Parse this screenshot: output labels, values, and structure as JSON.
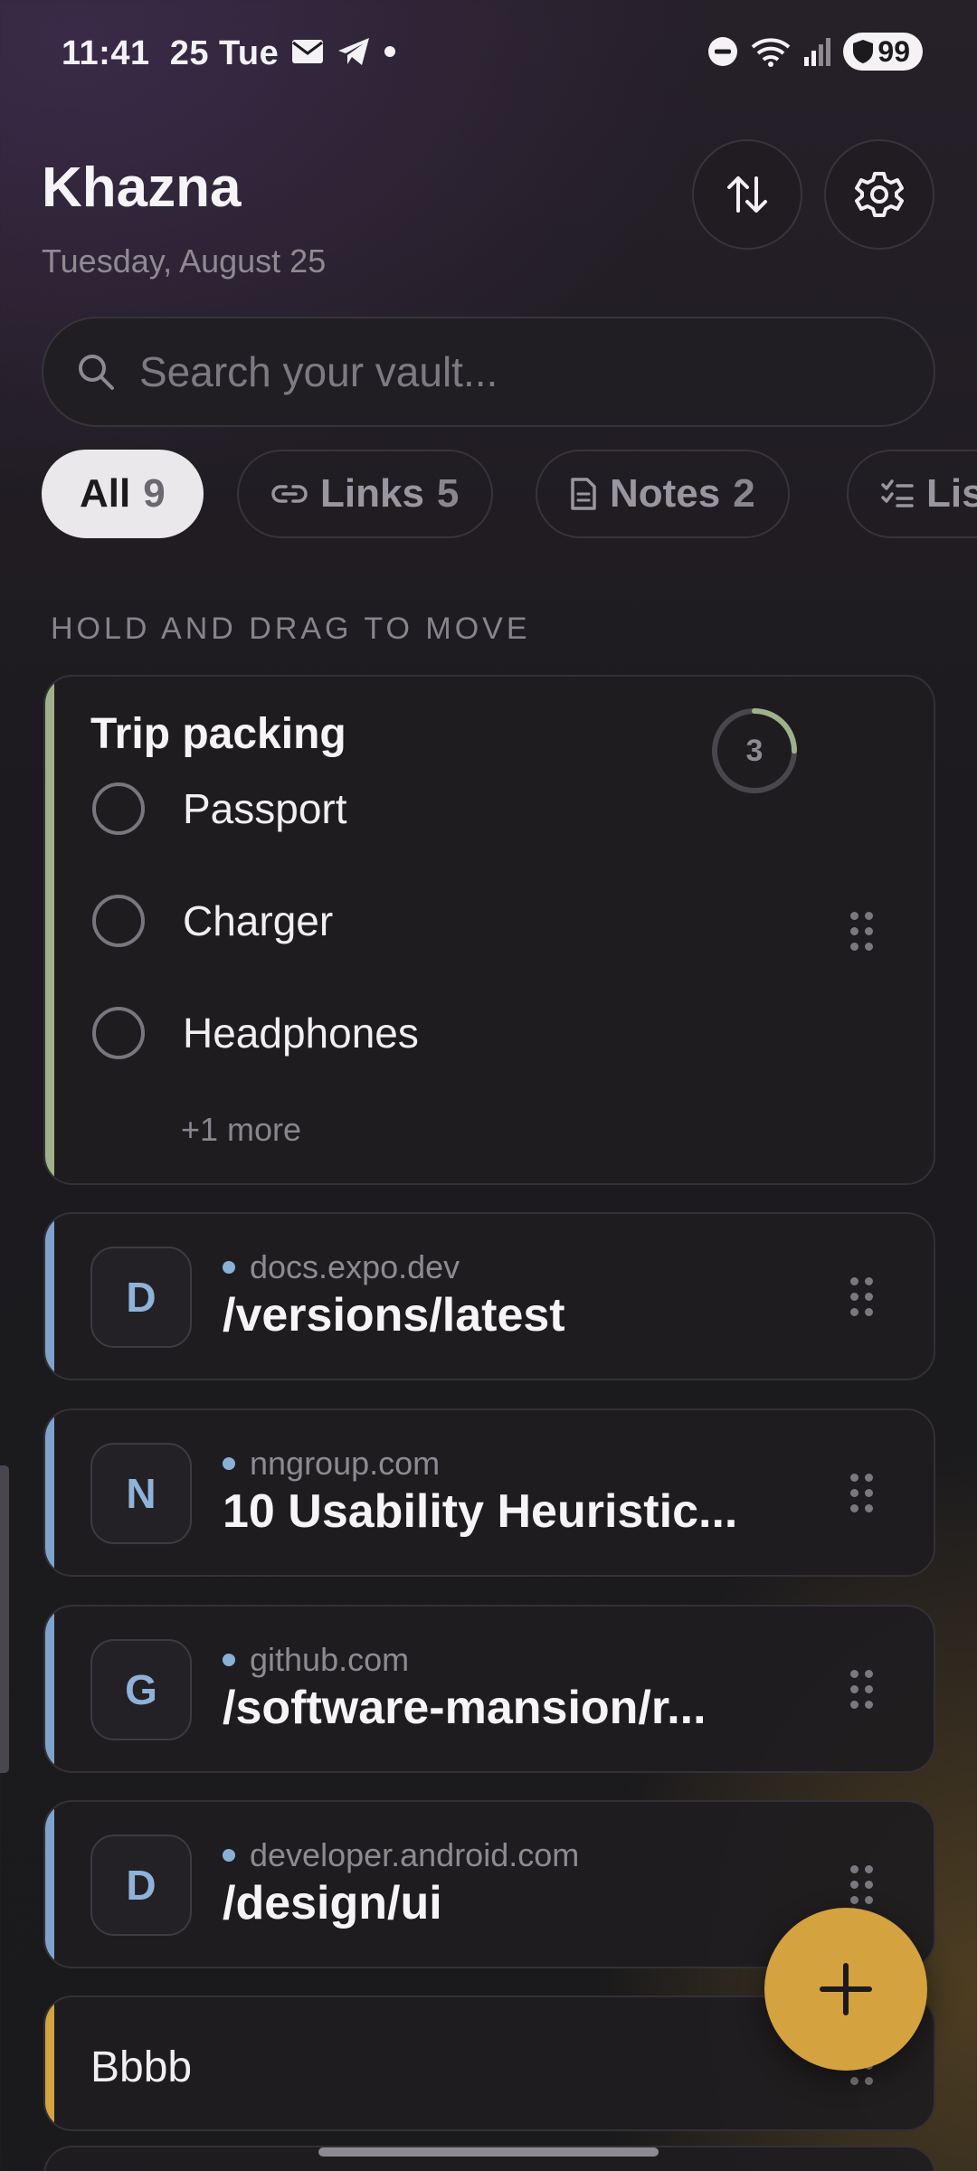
{
  "status_bar": {
    "time": "11:41",
    "date": "25 Tue",
    "battery": "99",
    "icons_left": [
      "mail-icon",
      "telegram-icon",
      "dot-icon"
    ],
    "icons_right": [
      "dnd-icon",
      "wifi-icon",
      "signal-icon",
      "battery-icon"
    ]
  },
  "header": {
    "title": "Khazna",
    "date": "Tuesday, August 25",
    "sort_icon": "sort-arrows-icon",
    "settings_icon": "gear-icon"
  },
  "search": {
    "placeholder": "Search your vault..."
  },
  "filters": [
    {
      "label": "All",
      "count": "9",
      "selected": true
    },
    {
      "label": "Links",
      "count": "5",
      "icon": "link-icon"
    },
    {
      "label": "Notes",
      "count": "2",
      "icon": "document-icon"
    },
    {
      "label": "Lis",
      "count": "",
      "icon": "checklist-icon"
    }
  ],
  "section_label": "HOLD AND DRAG TO MOVE",
  "list_card": {
    "title": "Trip packing",
    "progress_count": "3",
    "progress_fraction": 0.25,
    "items": [
      "Passport",
      "Charger",
      "Headphones"
    ],
    "more": "+1 more",
    "accent": "#9fb18a"
  },
  "links": [
    {
      "initial": "D",
      "domain": "docs.expo.dev",
      "title": "/versions/latest"
    },
    {
      "initial": "N",
      "domain": "nngroup.com",
      "title": "10 Usability Heuristic..."
    },
    {
      "initial": "G",
      "domain": "github.com",
      "title": "/software-mansion/r..."
    },
    {
      "initial": "D",
      "domain": "developer.android.com",
      "title": "/design/ui"
    }
  ],
  "link_accent": "#7fa3cc",
  "note": {
    "title": "Bbbb",
    "accent": "#d4a23e"
  },
  "fab": {
    "icon": "plus-icon",
    "color": "#d4a23e"
  }
}
